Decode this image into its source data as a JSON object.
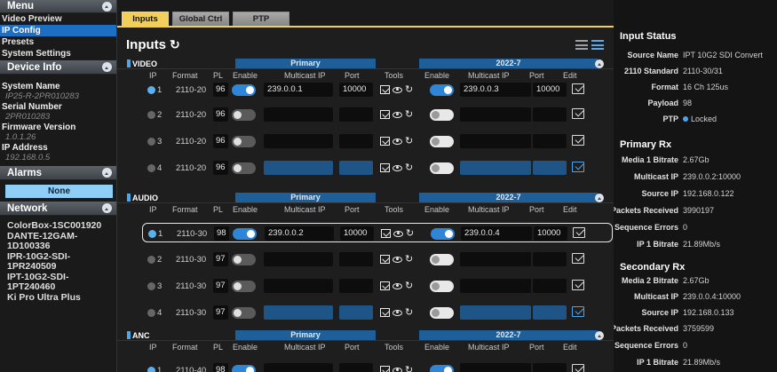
{
  "sidebar": {
    "menu_title": "Menu",
    "menu_items": [
      "Video Preview",
      "IP Config",
      "Presets",
      "System Settings"
    ],
    "device_info_title": "Device Info",
    "device_fields": [
      {
        "label": "System Name",
        "value": "IP25-R-2PR010283"
      },
      {
        "label": "Serial Number",
        "value": "2PR010283"
      },
      {
        "label": "Firmware Version",
        "value": "1.0.1.26"
      },
      {
        "label": "IP Address",
        "value": "192.168.0.5"
      }
    ],
    "alarms_title": "Alarms",
    "alarms_value": "None",
    "network_title": "Network",
    "network_items": [
      "ColorBox-1SC001920",
      "DANTE-12GAM-1D100336",
      "IPR-10G2-SDI-1PR240509",
      "IPT-10G2-SDI-1PT240460",
      "Ki Pro Ultra Plus"
    ]
  },
  "tabs": [
    "Inputs",
    "Global Ctrl",
    "PTP"
  ],
  "page_title": "Inputs",
  "columns": {
    "primary_band": "Primary",
    "secondary_band": "2022-7",
    "ip": "IP",
    "format": "Format",
    "pl": "PL",
    "enable": "Enable",
    "multicast_ip": "Multicast IP",
    "port": "Port",
    "tools": "Tools",
    "enable2": "Enable",
    "multicast_ip2": "Multicast IP",
    "port2": "Port",
    "edit": "Edit"
  },
  "sections": [
    {
      "name": "VIDEO",
      "rows": [
        {
          "n": "1",
          "format": "2110-20",
          "pl": "96",
          "mc1": "239.0.0.1",
          "port1": "10000",
          "mc2": "239.0.0.3",
          "port2": "10000"
        },
        {
          "n": "2",
          "format": "2110-20",
          "pl": "96",
          "mc1": "",
          "port1": "",
          "mc2": "",
          "port2": ""
        },
        {
          "n": "3",
          "format": "2110-20",
          "pl": "96",
          "mc1": "",
          "port1": "",
          "mc2": "",
          "port2": ""
        },
        {
          "n": "4",
          "format": "2110-20",
          "pl": "96",
          "mc1": "",
          "port1": "",
          "mc2": "",
          "port2": ""
        }
      ]
    },
    {
      "name": "AUDIO",
      "rows": [
        {
          "n": "1",
          "format": "2110-30",
          "pl": "98",
          "mc1": "239.0.0.2",
          "port1": "10000",
          "mc2": "239.0.0.4",
          "port2": "10000"
        },
        {
          "n": "2",
          "format": "2110-30",
          "pl": "97",
          "mc1": "",
          "port1": "",
          "mc2": "",
          "port2": ""
        },
        {
          "n": "3",
          "format": "2110-30",
          "pl": "97",
          "mc1": "",
          "port1": "",
          "mc2": "",
          "port2": ""
        },
        {
          "n": "4",
          "format": "2110-30",
          "pl": "97",
          "mc1": "",
          "port1": "",
          "mc2": "",
          "port2": ""
        }
      ]
    },
    {
      "name": "ANC",
      "rows": [
        {
          "n": "1",
          "format": "2110-40",
          "pl": "98",
          "mc1": "",
          "port1": "",
          "mc2": "",
          "port2": ""
        }
      ]
    }
  ],
  "status": {
    "title": "Input Status",
    "general": [
      {
        "k": "Source Name",
        "v": "IPT 10G2 SDI Convert"
      },
      {
        "k": "2110 Standard",
        "v": "2110-30/31"
      },
      {
        "k": "Format",
        "v": "16 Ch 125us"
      },
      {
        "k": "Payload",
        "v": "98"
      },
      {
        "k": "PTP",
        "v": "Locked"
      }
    ],
    "primary_title": "Primary Rx",
    "primary": [
      {
        "k": "Media 1 Bitrate",
        "v": "2.67Gb"
      },
      {
        "k": "Multicast IP",
        "v": "239.0.0.2:10000"
      },
      {
        "k": "Source IP",
        "v": "192.168.0.122"
      },
      {
        "k": "Packets Received",
        "v": "3990197"
      },
      {
        "k": "Sequence Errors",
        "v": "0"
      },
      {
        "k": "IP 1 Bitrate",
        "v": "21.89Mb/s"
      }
    ],
    "secondary_title": "Secondary Rx",
    "secondary": [
      {
        "k": "Media 2 Bitrate",
        "v": "2.67Gb"
      },
      {
        "k": "Multicast IP",
        "v": "239.0.0.4:10000"
      },
      {
        "k": "Source IP",
        "v": "192.168.0.133"
      },
      {
        "k": "Packets Received",
        "v": "3759599"
      },
      {
        "k": "Sequence Errors",
        "v": "0"
      },
      {
        "k": "IP 1 Bitrate",
        "v": "21.89Mb/s"
      }
    ]
  },
  "colors": {
    "accent": "#f2cf5d",
    "blue": "#1d6fc4",
    "band": "#1f5f99"
  }
}
